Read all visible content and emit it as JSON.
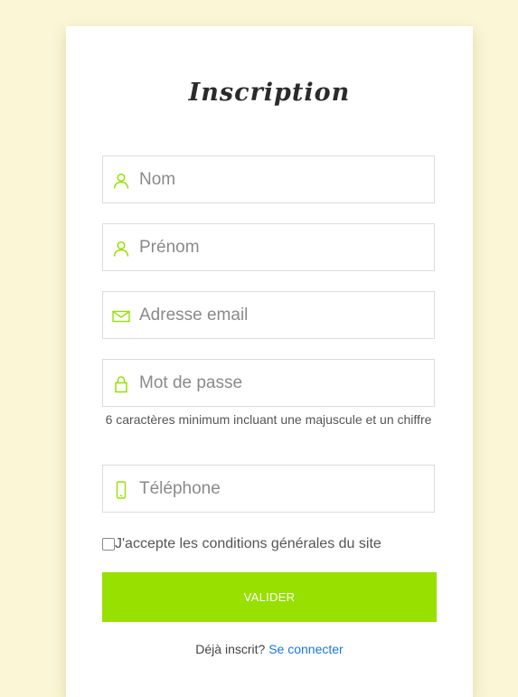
{
  "colors": {
    "page_background": "#fbf6d6",
    "accent": "#97e000",
    "link": "#1a79d6"
  },
  "form": {
    "title": "Inscription",
    "fields": [
      {
        "name": "nom",
        "icon": "user-icon",
        "placeholder": "Nom",
        "value": ""
      },
      {
        "name": "prenom",
        "icon": "user-icon",
        "placeholder": "Prénom",
        "value": ""
      },
      {
        "name": "email",
        "icon": "envelope-icon",
        "placeholder": "Adresse email",
        "value": ""
      },
      {
        "name": "password",
        "icon": "lock-icon",
        "placeholder": "Mot de passe",
        "value": ""
      },
      {
        "name": "telephone",
        "icon": "phone-icon",
        "placeholder": "Téléphone",
        "value": ""
      }
    ],
    "password_hint": "6 caractères minimum incluant une majuscule et un chiffre",
    "terms": {
      "label": "J'accepte les conditions générales du site",
      "checked": false
    },
    "submit_label": "VALIDER",
    "login_prompt": "Déjà inscrit?",
    "login_link": "Se connecter"
  }
}
